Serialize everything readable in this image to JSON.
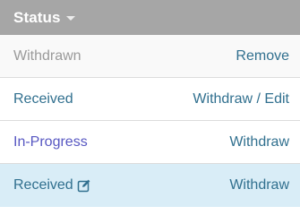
{
  "header": {
    "title": "Status",
    "sort_icon": "caret-down-icon"
  },
  "rows": [
    {
      "status": "Withdrawn",
      "action": "Remove"
    },
    {
      "status": "Received",
      "action": "Withdraw / Edit"
    },
    {
      "status": "In-Progress",
      "action": "Withdraw"
    },
    {
      "status": "Received",
      "action": "Withdraw",
      "status_icon": "edit-icon"
    }
  ],
  "colors": {
    "header_bg": "#a6a6a6",
    "selected_row_bg": "#d9edf7",
    "link": "#31708f",
    "muted_text": "#9a9a9a",
    "in_progress_text": "#5757c2"
  }
}
